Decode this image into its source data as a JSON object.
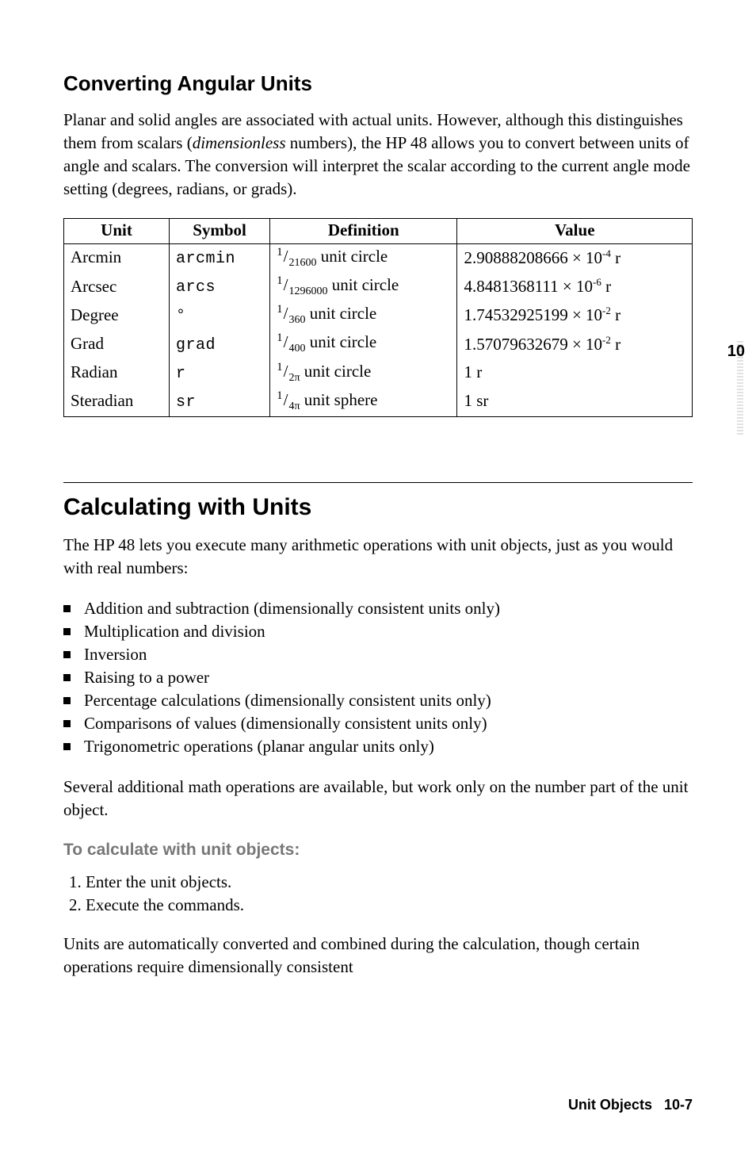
{
  "margin": {
    "chapter_number": "10"
  },
  "section1": {
    "title": "Converting Angular Units",
    "para": "Planar and solid angles are associated with actual units. However, although this distinguishes them from scalars (",
    "para_italic": "dimensionless",
    "para_tail": " numbers), the HP 48 allows you to convert between units of angle and scalars. The conversion will interpret the scalar according to the current angle mode setting (degrees, radians, or grads)."
  },
  "table": {
    "headers": {
      "unit": "Unit",
      "symbol": "Symbol",
      "definition": "Definition",
      "value": "Value"
    },
    "rows": [
      {
        "unit": "Arcmin",
        "symbol": "arcmin",
        "num": "1",
        "den": "21600",
        "def_tail": " unit circle",
        "val": "2.90888208666 × 10",
        "exp": "-4",
        "val_tail": " r"
      },
      {
        "unit": "Arcsec",
        "symbol": "arcs",
        "num": "1",
        "den": "1296000",
        "def_tail": " unit circle",
        "val": "4.8481368111 × 10",
        "exp": "-6",
        "val_tail": " r"
      },
      {
        "unit": "Degree",
        "symbol": "°",
        "num": "1",
        "den": "360",
        "def_tail": " unit circle",
        "val": "1.74532925199 × 10",
        "exp": "-2",
        "val_tail": " r"
      },
      {
        "unit": "Grad",
        "symbol": "grad",
        "num": "1",
        "den": "400",
        "def_tail": " unit circle",
        "val": "1.57079632679 × 10",
        "exp": "-2",
        "val_tail": " r"
      },
      {
        "unit": "Radian",
        "symbol": "r",
        "num": "1",
        "den": "2π",
        "def_tail": " unit circle",
        "val": "1 r",
        "exp": "",
        "val_tail": ""
      },
      {
        "unit": "Steradian",
        "symbol": "sr",
        "num": "1",
        "den": "4π",
        "def_tail": " unit sphere",
        "val": "1 sr",
        "exp": "",
        "val_tail": ""
      }
    ]
  },
  "section2": {
    "title": "Calculating with Units",
    "para": "The HP 48 lets you execute many arithmetic operations with unit objects, just as you would with real numbers:",
    "bullets": [
      "Addition and subtraction (dimensionally consistent units only)",
      "Multiplication and division",
      "Inversion",
      "Raising to a power",
      "Percentage calculations (dimensionally consistent units only)",
      "Comparisons of values (dimensionally consistent units only)",
      "Trigonometric operations (planar angular units only)"
    ],
    "para2": "Several additional math operations are available, but work only on the number part of the unit object.",
    "subhead": "To calculate with unit objects:",
    "steps": [
      "Enter the unit objects.",
      "Execute the commands."
    ],
    "para3": "Units are automatically converted and combined during the calculation, though certain operations require dimensionally consistent"
  },
  "footer": {
    "left": "Unit Objects",
    "right": "10-7"
  }
}
